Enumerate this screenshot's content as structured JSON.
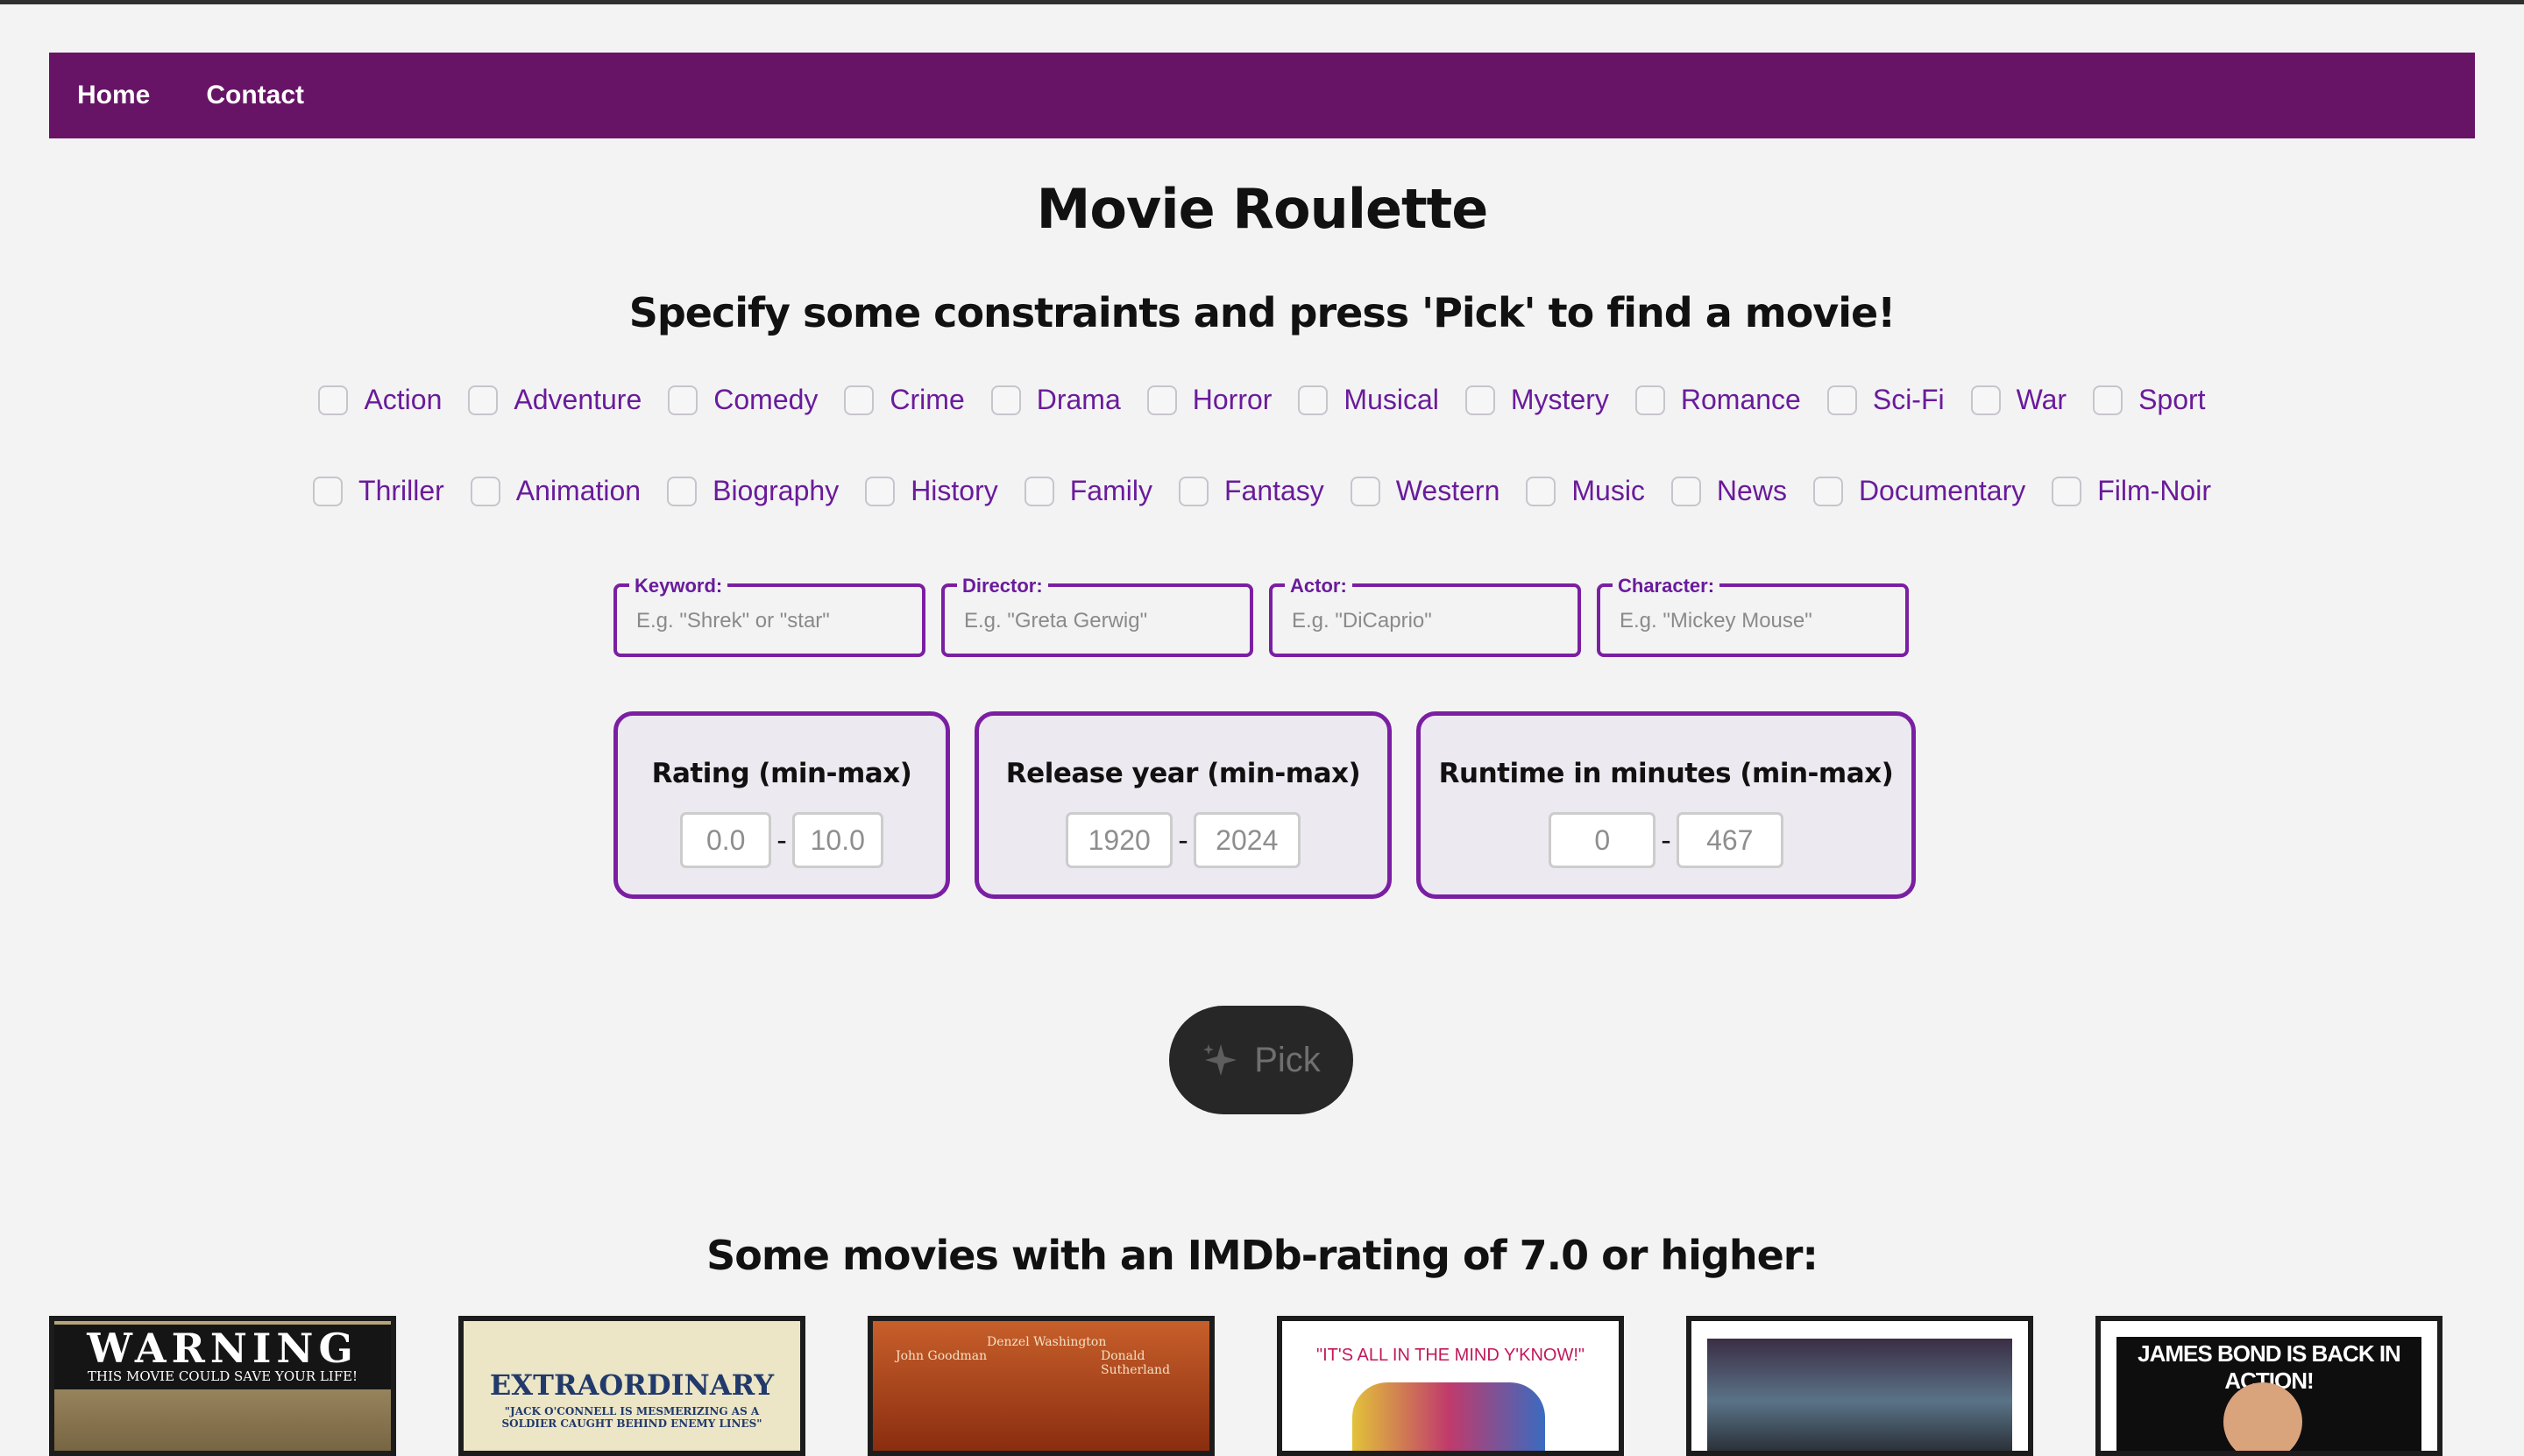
{
  "nav": {
    "items": [
      "Home",
      "Contact"
    ]
  },
  "page": {
    "title": "Movie Roulette",
    "subtitle": "Specify some constraints and press 'Pick' to find a movie!",
    "section_title": "Some movies with an IMDb-rating of 7.0 or higher:"
  },
  "genres_row1": [
    "Action",
    "Adventure",
    "Comedy",
    "Crime",
    "Drama",
    "Horror",
    "Musical",
    "Mystery",
    "Romance",
    "Sci-Fi",
    "War",
    "Sport"
  ],
  "genres_row2": [
    "Thriller",
    "Animation",
    "Biography",
    "History",
    "Family",
    "Fantasy",
    "Western",
    "Music",
    "News",
    "Documentary",
    "Film-Noir"
  ],
  "fields": {
    "keyword": {
      "label": "Keyword:",
      "placeholder": "E.g. \"Shrek\" or \"star\""
    },
    "director": {
      "label": "Director:",
      "placeholder": "E.g. \"Greta Gerwig\""
    },
    "actor": {
      "label": "Actor:",
      "placeholder": "E.g. \"DiCaprio\""
    },
    "character": {
      "label": "Character:",
      "placeholder": "E.g. \"Mickey Mouse\""
    }
  },
  "ranges": {
    "rating": {
      "title": "Rating (min-max)",
      "min": "0.0",
      "max": "10.0"
    },
    "year": {
      "title": "Release year (min-max)",
      "min": "1920",
      "max": "2024"
    },
    "runtime": {
      "title": "Runtime in minutes (min-max)",
      "min": "0",
      "max": "467"
    }
  },
  "pick_button": {
    "label": "Pick"
  },
  "posters": {
    "p1": {
      "line1": "WARNING",
      "line2": "THIS MOVIE COULD SAVE YOUR LIFE!"
    },
    "p2": {
      "title": "EXTRAORDINARY",
      "tagline": "\"JACK O'CONNELL IS MESMERIZING AS A SOLDIER CAUGHT BEHIND ENEMY LINES\""
    },
    "p3": {
      "name1": "John Goodman",
      "name2": "Denzel Washington",
      "name3": "Donald Sutherland"
    },
    "p4": {
      "text": "\"IT'S ALL IN THE MIND Y'KNOW!\""
    },
    "p6": {
      "text": "JAMES BOND IS BACK IN ACTION!"
    }
  },
  "colors": {
    "nav_bg": "#671466",
    "accent": "#7b1fa2",
    "genre_text": "#6a1b9a",
    "pick_bg": "#272727"
  }
}
